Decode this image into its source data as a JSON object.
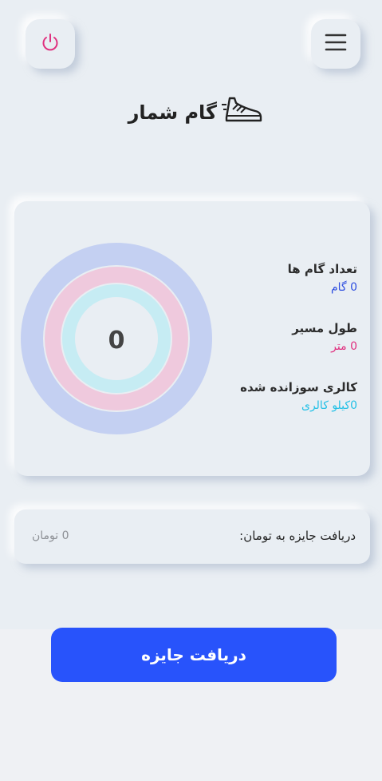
{
  "header": {
    "title": "گام شمار",
    "power_icon": "power-icon",
    "menu_icon": "hamburger-menu-icon",
    "logo_icon": "sneaker-icon"
  },
  "stats": {
    "ring_value": "0",
    "items": [
      {
        "label": "تعداد گام ها",
        "value": "0 گام",
        "color": "#2f4fe0"
      },
      {
        "label": "طول مسیر",
        "value": "0 متر",
        "color": "#e0307f"
      },
      {
        "label": "کالری سوزانده شده",
        "value": "0کیلو کالری",
        "color": "#22c0e6"
      }
    ]
  },
  "reward": {
    "label": "دریافت جایزه به تومان:",
    "value": "0 تومان"
  },
  "actions": {
    "claim_label": "دریافت جایزه"
  },
  "colors": {
    "accent": "#2853fb",
    "ring_outer": "#c4d0f2",
    "ring_middle": "#efc9dd",
    "ring_inner": "#c6ecf3",
    "power": "#e0307f"
  }
}
